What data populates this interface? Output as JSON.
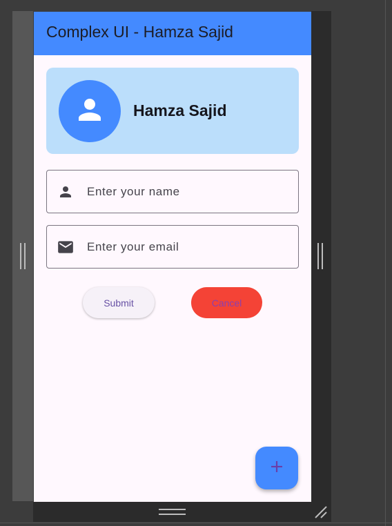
{
  "app_bar": {
    "title": "Complex UI - Hamza Sajid",
    "color": "#448aff"
  },
  "profile": {
    "name": "Hamza Sajid",
    "avatar_icon": "person-icon",
    "card_color": "#bbdefb"
  },
  "form": {
    "name_field": {
      "icon": "person-icon",
      "placeholder": "Enter your name",
      "value": ""
    },
    "email_field": {
      "icon": "email-icon",
      "placeholder": "Enter your email",
      "value": ""
    }
  },
  "buttons": {
    "submit_label": "Submit",
    "cancel_label": "Cancel",
    "cancel_color": "#f44336"
  },
  "fab": {
    "icon": "add-icon"
  }
}
